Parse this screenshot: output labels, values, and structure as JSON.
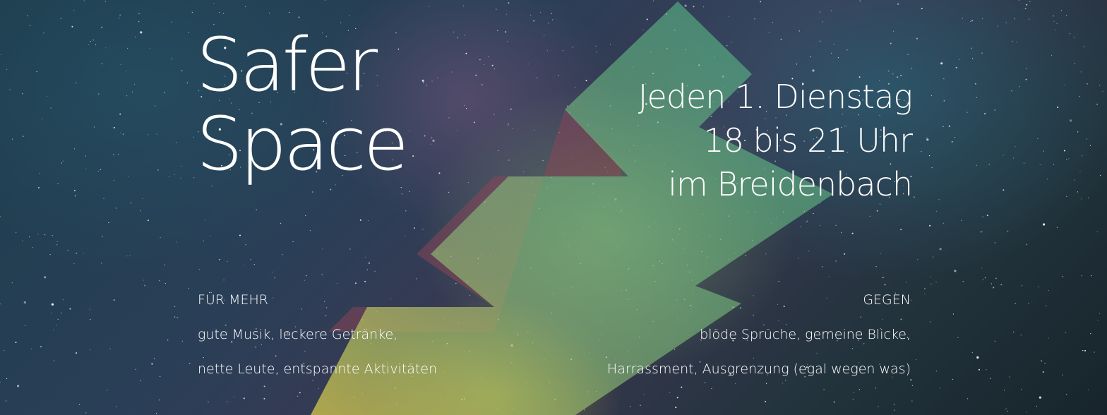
{
  "title": {
    "line1": "Safer",
    "line2": "Space"
  },
  "schedule": {
    "line1": "Jeden 1. Dienstag",
    "line2": "18 bis 21 Uhr",
    "line3": "im Breidenbach"
  },
  "for_more": {
    "heading": "FÜR MEHR",
    "line1": "gute Musik, leckere Getränke,",
    "line2": "nette Leute, entspannte Aktivitäten"
  },
  "against": {
    "heading": "GEGEN",
    "line1": "blöde Sprüche, gemeine Blicke,",
    "line2": "Harrassment, Ausgrenzung (egal wegen was)"
  },
  "colors": {
    "text": "#ffffff",
    "arrow_green": "#5fbf94",
    "arrow_yellow": "#d9c84a",
    "arrow_purple": "#7a3a6a"
  }
}
